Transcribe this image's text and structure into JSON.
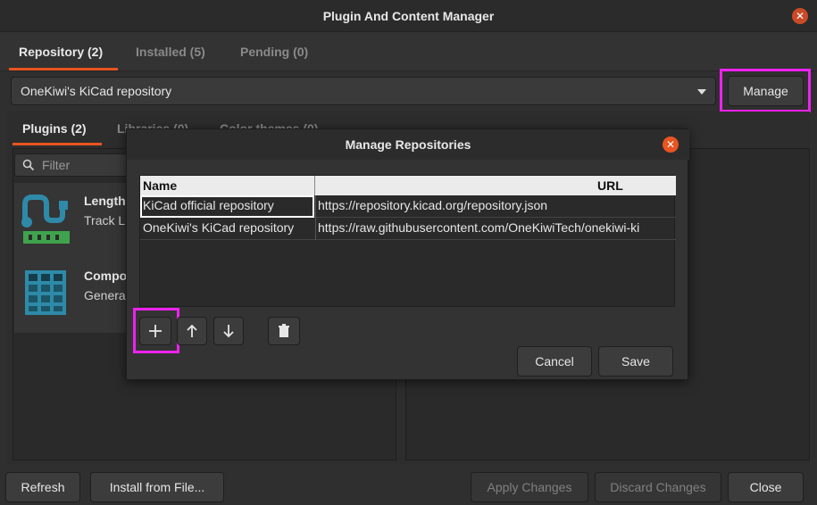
{
  "window": {
    "title": "Plugin And Content Manager"
  },
  "top_tabs": [
    {
      "label": "Repository (2)"
    },
    {
      "label": "Installed (5)"
    },
    {
      "label": "Pending (0)"
    }
  ],
  "repo_combo": {
    "selected": "OneKiwi's KiCad repository"
  },
  "manage_button": "Manage",
  "sub_tabs": [
    {
      "label": "Plugins (2)"
    },
    {
      "label": "Libraries (0)"
    },
    {
      "label": "Color themes (0)"
    }
  ],
  "filter": {
    "placeholder": "Filter"
  },
  "plugins": [
    {
      "name": "Length",
      "desc": "Track L"
    },
    {
      "name": "Compo",
      "desc": "Genera"
    }
  ],
  "dialog": {
    "title": "Manage Repositories",
    "columns": {
      "name": "Name",
      "url": "URL"
    },
    "rows": [
      {
        "name": "KiCad official repository",
        "url": "https://repository.kicad.org/repository.json"
      },
      {
        "name": "OneKiwi's KiCad repository",
        "url": "https://raw.githubusercontent.com/OneKiwiTech/onekiwi-ki"
      }
    ],
    "cancel": "Cancel",
    "save": "Save"
  },
  "bottom": {
    "refresh": "Refresh",
    "install_from_file": "Install from File...",
    "apply_changes": "Apply Changes",
    "discard_changes": "Discard Changes",
    "close": "Close"
  },
  "colors": {
    "accent": "#e95420",
    "highlight": "#ee22ee"
  }
}
